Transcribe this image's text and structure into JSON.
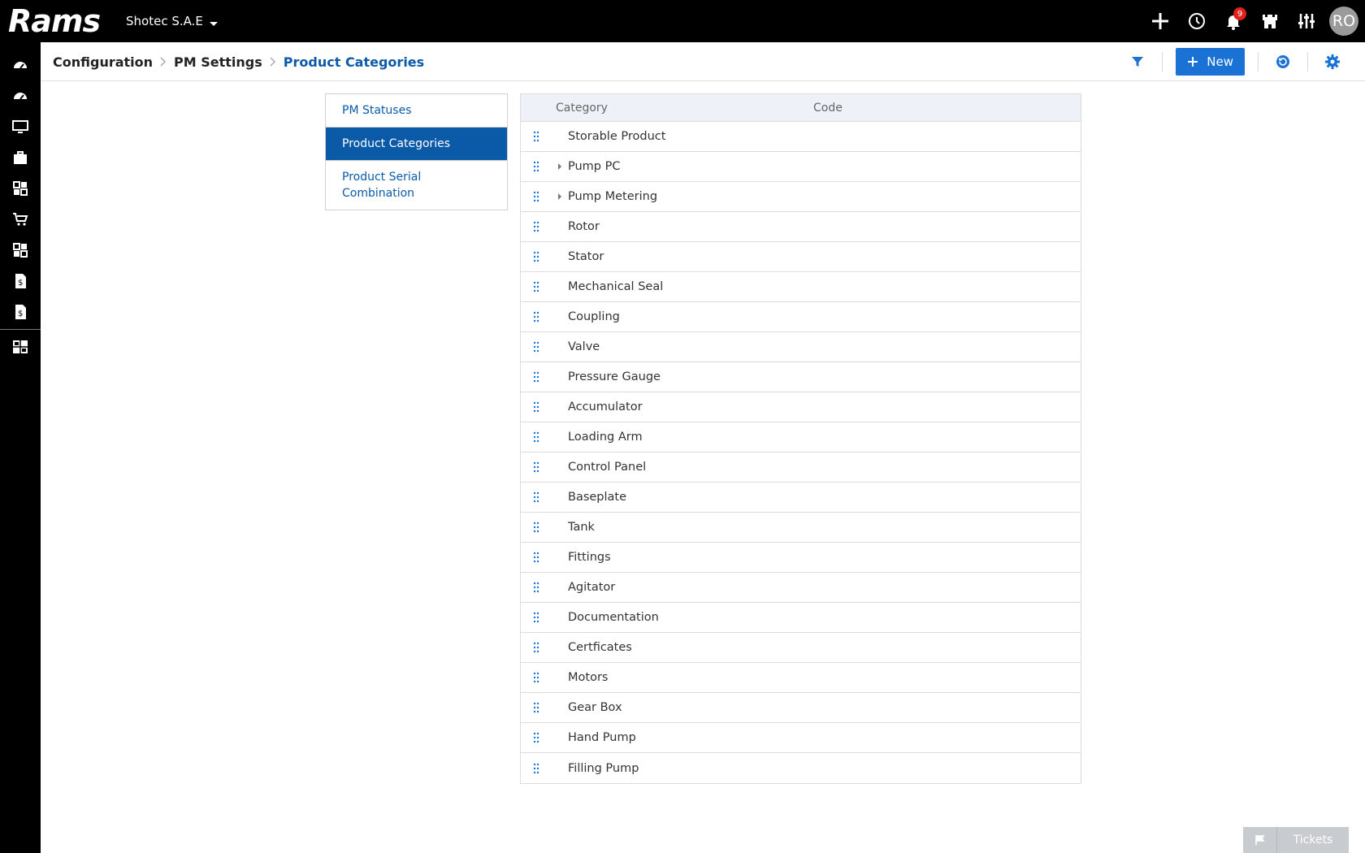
{
  "app": {
    "logo": "Rams",
    "company": "Shotec S.A.E"
  },
  "topbar": {
    "notification_count": "9",
    "avatar_initials": "RO"
  },
  "breadcrumb": {
    "level1": "Configuration",
    "level2": "PM Settings",
    "current": "Product Categories"
  },
  "actions": {
    "new_label": "New"
  },
  "menu": {
    "items": [
      {
        "label": "PM Statuses"
      },
      {
        "label": "Product Categories"
      },
      {
        "label": "Product Serial Combination"
      }
    ]
  },
  "table": {
    "headers": {
      "category": "Category",
      "code": "Code"
    },
    "rows": [
      {
        "category": "Storable Product",
        "expandable": false
      },
      {
        "category": "Pump PC",
        "expandable": true
      },
      {
        "category": "Pump Metering",
        "expandable": true
      },
      {
        "category": "Rotor",
        "expandable": false
      },
      {
        "category": "Stator",
        "expandable": false
      },
      {
        "category": "Mechanical Seal",
        "expandable": false
      },
      {
        "category": "Coupling",
        "expandable": false
      },
      {
        "category": "Valve",
        "expandable": false
      },
      {
        "category": "Pressure Gauge",
        "expandable": false
      },
      {
        "category": "Accumulator",
        "expandable": false
      },
      {
        "category": "Loading Arm",
        "expandable": false
      },
      {
        "category": "Control Panel",
        "expandable": false
      },
      {
        "category": "Baseplate",
        "expandable": false
      },
      {
        "category": "Tank",
        "expandable": false
      },
      {
        "category": "Fittings",
        "expandable": false
      },
      {
        "category": "Agitator",
        "expandable": false
      },
      {
        "category": "Documentation",
        "expandable": false
      },
      {
        "category": "Certficates",
        "expandable": false
      },
      {
        "category": "Motors",
        "expandable": false
      },
      {
        "category": "Gear Box",
        "expandable": false
      },
      {
        "category": "Hand Pump",
        "expandable": false
      },
      {
        "category": "Filling Pump",
        "expandable": false
      }
    ]
  },
  "footer": {
    "tickets_label": "Tickets"
  },
  "colors": {
    "accent": "#0a5aa8",
    "button": "#1a73d4",
    "badge": "#e0201b"
  }
}
